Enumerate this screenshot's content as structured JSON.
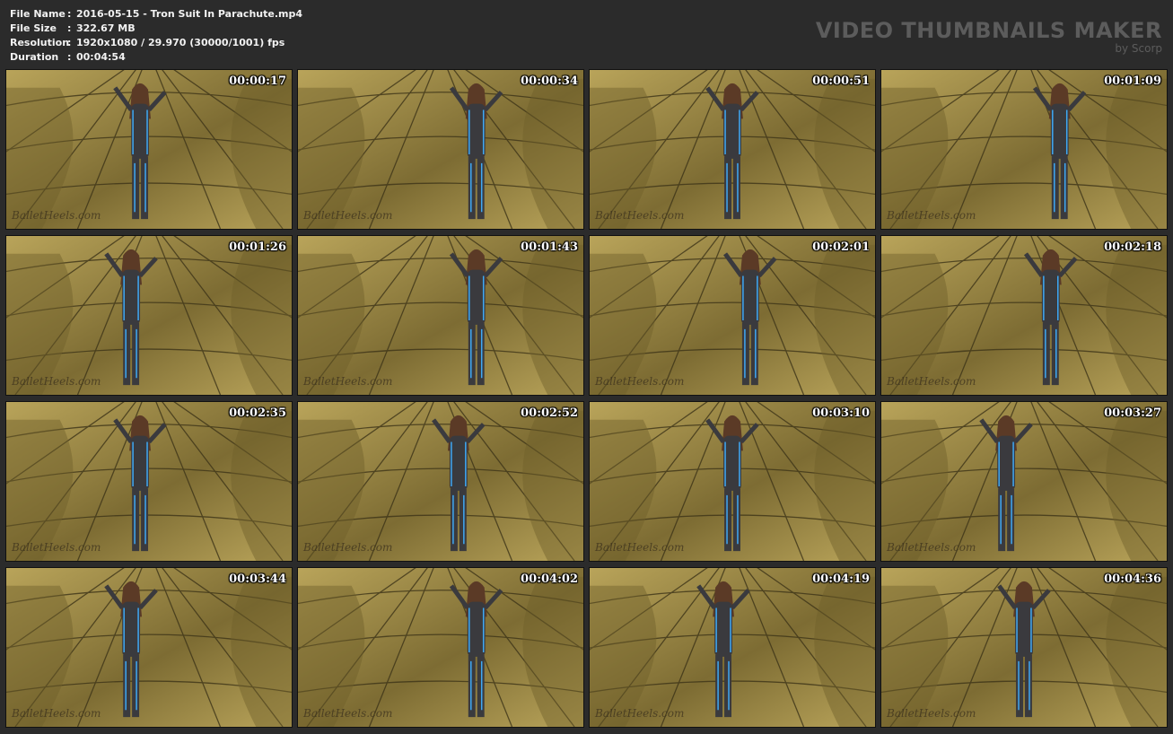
{
  "file_info": {
    "file_name_label": "File Name",
    "file_name_value": "2016-05-15 - Tron Suit In Parachute.mp4",
    "file_size_label": "File Size",
    "file_size_value": "322.67 MB",
    "resolution_label": "Resolution",
    "resolution_value": "1920x1080 / 29.970 (30000/1001) fps",
    "duration_label": "Duration",
    "duration_value": "00:04:54",
    "separator": ":"
  },
  "brand": {
    "title": "VIDEO THUMBNAILS MAKER",
    "subtitle": "by Scorp"
  },
  "watermark": "BalletHeels.com",
  "colors": {
    "background": "#2b2b2b",
    "fabric_light": "#b9a45a",
    "fabric_dark": "#7d6c33",
    "suit": "#3a3a3e",
    "suit_accent": "#3fa9f5"
  },
  "thumbnails": [
    {
      "time": "00:00:17"
    },
    {
      "time": "00:00:34"
    },
    {
      "time": "00:00:51"
    },
    {
      "time": "00:01:09"
    },
    {
      "time": "00:01:26"
    },
    {
      "time": "00:01:43"
    },
    {
      "time": "00:02:01"
    },
    {
      "time": "00:02:18"
    },
    {
      "time": "00:02:35"
    },
    {
      "time": "00:02:52"
    },
    {
      "time": "00:03:10"
    },
    {
      "time": "00:03:27"
    },
    {
      "time": "00:03:44"
    },
    {
      "time": "00:04:02"
    },
    {
      "time": "00:04:19"
    },
    {
      "time": "00:04:36"
    }
  ]
}
